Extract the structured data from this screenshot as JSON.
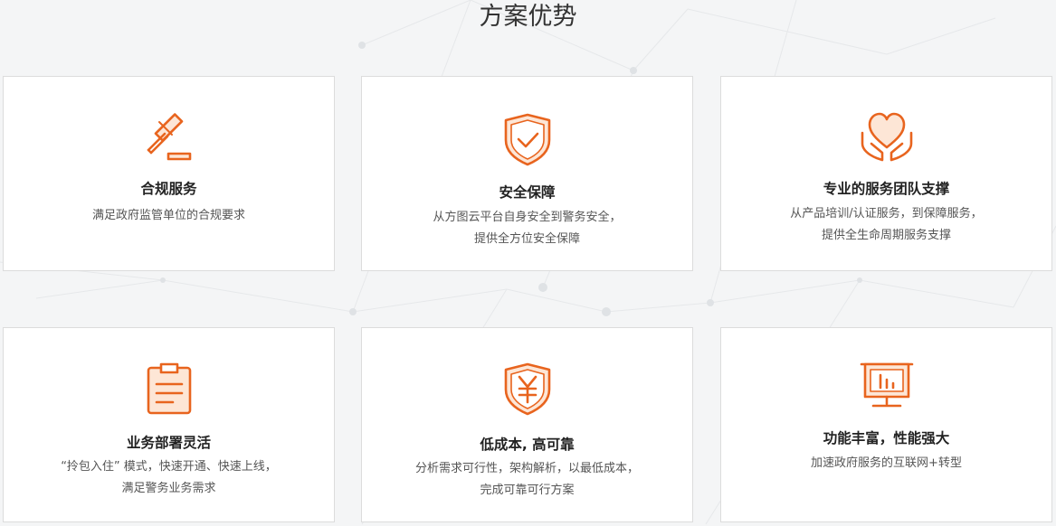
{
  "section": {
    "title": "方案优势"
  },
  "cards": [
    {
      "icon": "gavel-icon",
      "title": "合规服务",
      "desc": [
        "满足政府监管单位的合规要求"
      ]
    },
    {
      "icon": "shield-check-icon",
      "title": "安全保障",
      "desc": [
        "从方图云平台自身安全到警务安全，",
        "提供全方位安全保障"
      ]
    },
    {
      "icon": "heart-hands-icon",
      "title": "专业的服务团队支撑",
      "desc": [
        "从产品培训/认证服务，到保障服务，",
        "提供全生命周期服务支撑"
      ]
    },
    {
      "icon": "clipboard-icon",
      "title": "业务部署灵活",
      "desc": [
        "“拎包入住” 模式，快速开通、快速上线，",
        "满足警务业务需求"
      ]
    },
    {
      "icon": "shield-yen-icon",
      "title": "低成本, 高可靠",
      "desc": [
        "分析需求可行性，架构解析，以最低成本，",
        "完成可靠可行方案"
      ]
    },
    {
      "icon": "presentation-chart-icon",
      "title": "功能丰富，性能强大",
      "desc": [
        "加速政府服务的互联网+转型"
      ]
    }
  ],
  "colors": {
    "accent": "#e8641e",
    "card_border": "#dcdcdc",
    "background": "#f4f5f6"
  }
}
